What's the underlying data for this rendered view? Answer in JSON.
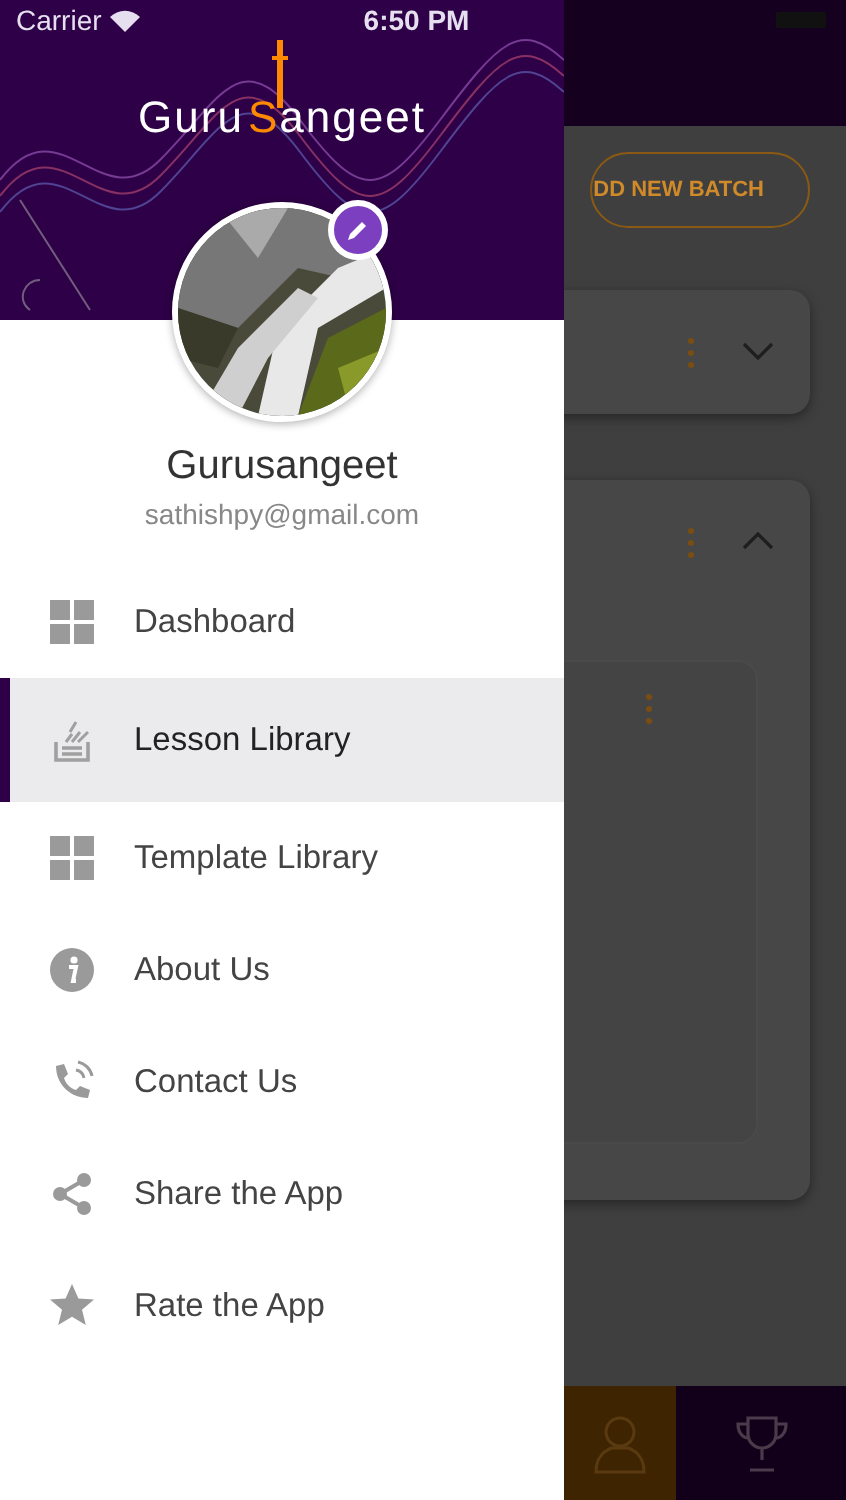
{
  "status_bar": {
    "carrier": "Carrier",
    "time": "6:50 PM"
  },
  "background_screen": {
    "add_button": "DD NEW BATCH",
    "cards": [
      {
        "expanded": false
      },
      {
        "expanded": true
      }
    ],
    "bottom_tabs": [
      {
        "selected": true
      },
      {
        "selected": false
      }
    ]
  },
  "drawer": {
    "logo": {
      "first": "Guru",
      "second": "Sangeet"
    },
    "profile": {
      "name": "Gurusangeet",
      "email": "sathishpy@gmail.com"
    },
    "menu": [
      {
        "label": "Dashboard",
        "selected": false
      },
      {
        "label": "Lesson Library",
        "selected": true
      },
      {
        "label": "Template Library",
        "selected": false
      },
      {
        "label": "About Us",
        "selected": false
      },
      {
        "label": "Contact Us",
        "selected": false
      },
      {
        "label": "Share the App",
        "selected": false
      },
      {
        "label": "Rate the App",
        "selected": false
      }
    ]
  }
}
